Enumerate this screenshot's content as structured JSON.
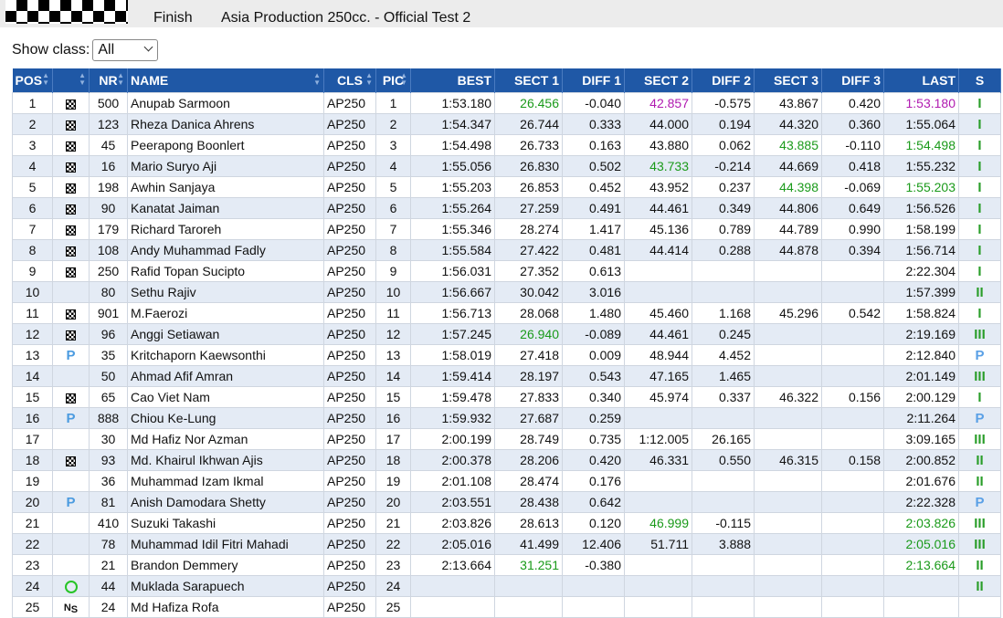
{
  "header": {
    "status": "Finish",
    "title": "Asia Production 250cc. - Official Test 2"
  },
  "filter": {
    "label": "Show class:",
    "value": "All"
  },
  "columns": [
    "POS",
    "",
    "NR",
    "NAME",
    "CLS",
    "PIC",
    "BEST",
    "SECT 1",
    "DIFF 1",
    "SECT 2",
    "DIFF 2",
    "SECT 3",
    "DIFF 3",
    "LAST",
    "S"
  ],
  "colors": {
    "header_bg": "#1f58a6",
    "alt_row": "#e4ebf5",
    "best_green": "#1a9a1a",
    "overall_purple": "#b01ab0"
  },
  "rows": [
    {
      "pos": "1",
      "icon": "checkered",
      "nr": "500",
      "name": "Anupab Sarmoon",
      "cls": "AP250",
      "pic": "1",
      "best": "1:53.180",
      "s1": "26.456",
      "s1c": "green",
      "d1": "-0.040",
      "s2": "42.857",
      "s2c": "purple",
      "d2": "-0.575",
      "s3": "43.867",
      "s3c": "",
      "d3": "0.420",
      "last": "1:53.180",
      "lastc": "purple",
      "s": "I"
    },
    {
      "pos": "2",
      "icon": "checkered",
      "nr": "123",
      "name": "Rheza Danica Ahrens",
      "cls": "AP250",
      "pic": "2",
      "best": "1:54.347",
      "s1": "26.744",
      "s1c": "",
      "d1": "0.333",
      "s2": "44.000",
      "s2c": "",
      "d2": "0.194",
      "s3": "44.320",
      "s3c": "",
      "d3": "0.360",
      "last": "1:55.064",
      "lastc": "",
      "s": "I"
    },
    {
      "pos": "3",
      "icon": "checkered",
      "nr": "45",
      "name": "Peerapong Boonlert",
      "cls": "AP250",
      "pic": "3",
      "best": "1:54.498",
      "s1": "26.733",
      "s1c": "",
      "d1": "0.163",
      "s2": "43.880",
      "s2c": "",
      "d2": "0.062",
      "s3": "43.885",
      "s3c": "green",
      "d3": "-0.110",
      "last": "1:54.498",
      "lastc": "green",
      "s": "I"
    },
    {
      "pos": "4",
      "icon": "checkered",
      "nr": "16",
      "name": "Mario Suryo Aji",
      "cls": "AP250",
      "pic": "4",
      "best": "1:55.056",
      "s1": "26.830",
      "s1c": "",
      "d1": "0.502",
      "s2": "43.733",
      "s2c": "green",
      "d2": "-0.214",
      "s3": "44.669",
      "s3c": "",
      "d3": "0.418",
      "last": "1:55.232",
      "lastc": "",
      "s": "I"
    },
    {
      "pos": "5",
      "icon": "checkered",
      "nr": "198",
      "name": "Awhin Sanjaya",
      "cls": "AP250",
      "pic": "5",
      "best": "1:55.203",
      "s1": "26.853",
      "s1c": "",
      "d1": "0.452",
      "s2": "43.952",
      "s2c": "",
      "d2": "0.237",
      "s3": "44.398",
      "s3c": "green",
      "d3": "-0.069",
      "last": "1:55.203",
      "lastc": "green",
      "s": "I"
    },
    {
      "pos": "6",
      "icon": "checkered",
      "nr": "90",
      "name": "Kanatat Jaiman",
      "cls": "AP250",
      "pic": "6",
      "best": "1:55.264",
      "s1": "27.259",
      "s1c": "",
      "d1": "0.491",
      "s2": "44.461",
      "s2c": "",
      "d2": "0.349",
      "s3": "44.806",
      "s3c": "",
      "d3": "0.649",
      "last": "1:56.526",
      "lastc": "",
      "s": "I"
    },
    {
      "pos": "7",
      "icon": "checkered",
      "nr": "179",
      "name": "Richard Taroreh",
      "cls": "AP250",
      "pic": "7",
      "best": "1:55.346",
      "s1": "28.274",
      "s1c": "",
      "d1": "1.417",
      "s2": "45.136",
      "s2c": "",
      "d2": "0.789",
      "s3": "44.789",
      "s3c": "",
      "d3": "0.990",
      "last": "1:58.199",
      "lastc": "",
      "s": "I"
    },
    {
      "pos": "8",
      "icon": "checkered",
      "nr": "108",
      "name": "Andy Muhammad Fadly",
      "cls": "AP250",
      "pic": "8",
      "best": "1:55.584",
      "s1": "27.422",
      "s1c": "",
      "d1": "0.481",
      "s2": "44.414",
      "s2c": "",
      "d2": "0.288",
      "s3": "44.878",
      "s3c": "",
      "d3": "0.394",
      "last": "1:56.714",
      "lastc": "",
      "s": "I"
    },
    {
      "pos": "9",
      "icon": "checkered",
      "nr": "250",
      "name": "Rafid Topan Sucipto",
      "cls": "AP250",
      "pic": "9",
      "best": "1:56.031",
      "s1": "27.352",
      "s1c": "",
      "d1": "0.613",
      "s2": "",
      "s2c": "",
      "d2": "",
      "s3": "",
      "s3c": "",
      "d3": "",
      "last": "2:22.304",
      "lastc": "",
      "s": "I"
    },
    {
      "pos": "10",
      "icon": "",
      "nr": "80",
      "name": "Sethu Rajiv",
      "cls": "AP250",
      "pic": "10",
      "best": "1:56.667",
      "s1": "30.042",
      "s1c": "",
      "d1": "3.016",
      "s2": "",
      "s2c": "",
      "d2": "",
      "s3": "",
      "s3c": "",
      "d3": "",
      "last": "1:57.399",
      "lastc": "",
      "s": "II"
    },
    {
      "pos": "11",
      "icon": "checkered",
      "nr": "901",
      "name": "M.Faerozi",
      "cls": "AP250",
      "pic": "11",
      "best": "1:56.713",
      "s1": "28.068",
      "s1c": "",
      "d1": "1.480",
      "s2": "45.460",
      "s2c": "",
      "d2": "1.168",
      "s3": "45.296",
      "s3c": "",
      "d3": "0.542",
      "last": "1:58.824",
      "lastc": "",
      "s": "I"
    },
    {
      "pos": "12",
      "icon": "checkered",
      "nr": "96",
      "name": "Anggi Setiawan",
      "cls": "AP250",
      "pic": "12",
      "best": "1:57.245",
      "s1": "26.940",
      "s1c": "green",
      "d1": "-0.089",
      "s2": "44.461",
      "s2c": "",
      "d2": "0.245",
      "s3": "",
      "s3c": "",
      "d3": "",
      "last": "2:19.169",
      "lastc": "",
      "s": "III"
    },
    {
      "pos": "13",
      "icon": "pit",
      "nr": "35",
      "name": "Kritchaporn Kaewsonthi",
      "cls": "AP250",
      "pic": "13",
      "best": "1:58.019",
      "s1": "27.418",
      "s1c": "",
      "d1": "0.009",
      "s2": "48.944",
      "s2c": "",
      "d2": "4.452",
      "s3": "",
      "s3c": "",
      "d3": "",
      "last": "2:12.840",
      "lastc": "",
      "s": "P"
    },
    {
      "pos": "14",
      "icon": "",
      "nr": "50",
      "name": "Ahmad Afif Amran",
      "cls": "AP250",
      "pic": "14",
      "best": "1:59.414",
      "s1": "28.197",
      "s1c": "",
      "d1": "0.543",
      "s2": "47.165",
      "s2c": "",
      "d2": "1.465",
      "s3": "",
      "s3c": "",
      "d3": "",
      "last": "2:01.149",
      "lastc": "",
      "s": "III"
    },
    {
      "pos": "15",
      "icon": "checkered",
      "nr": "65",
      "name": "Cao Viet Nam",
      "cls": "AP250",
      "pic": "15",
      "best": "1:59.478",
      "s1": "27.833",
      "s1c": "",
      "d1": "0.340",
      "s2": "45.974",
      "s2c": "",
      "d2": "0.337",
      "s3": "46.322",
      "s3c": "",
      "d3": "0.156",
      "last": "2:00.129",
      "lastc": "",
      "s": "I"
    },
    {
      "pos": "16",
      "icon": "pit",
      "nr": "888",
      "name": "Chiou Ke-Lung",
      "cls": "AP250",
      "pic": "16",
      "best": "1:59.932",
      "s1": "27.687",
      "s1c": "",
      "d1": "0.259",
      "s2": "",
      "s2c": "",
      "d2": "",
      "s3": "",
      "s3c": "",
      "d3": "",
      "last": "2:11.264",
      "lastc": "",
      "s": "P"
    },
    {
      "pos": "17",
      "icon": "",
      "nr": "30",
      "name": "Md Hafiz Nor Azman",
      "cls": "AP250",
      "pic": "17",
      "best": "2:00.199",
      "s1": "28.749",
      "s1c": "",
      "d1": "0.735",
      "s2": "1:12.005",
      "s2c": "",
      "d2": "26.165",
      "s3": "",
      "s3c": "",
      "d3": "",
      "last": "3:09.165",
      "lastc": "",
      "s": "III"
    },
    {
      "pos": "18",
      "icon": "checkered",
      "nr": "93",
      "name": "Md. Khairul Ikhwan Ajis",
      "cls": "AP250",
      "pic": "18",
      "best": "2:00.378",
      "s1": "28.206",
      "s1c": "",
      "d1": "0.420",
      "s2": "46.331",
      "s2c": "",
      "d2": "0.550",
      "s3": "46.315",
      "s3c": "",
      "d3": "0.158",
      "last": "2:00.852",
      "lastc": "",
      "s": "II"
    },
    {
      "pos": "19",
      "icon": "",
      "nr": "36",
      "name": "Muhammad Izam Ikmal",
      "cls": "AP250",
      "pic": "19",
      "best": "2:01.108",
      "s1": "28.474",
      "s1c": "",
      "d1": "0.176",
      "s2": "",
      "s2c": "",
      "d2": "",
      "s3": "",
      "s3c": "",
      "d3": "",
      "last": "2:01.676",
      "lastc": "",
      "s": "II"
    },
    {
      "pos": "20",
      "icon": "pit",
      "nr": "81",
      "name": "Anish Damodara Shetty",
      "cls": "AP250",
      "pic": "20",
      "best": "2:03.551",
      "s1": "28.438",
      "s1c": "",
      "d1": "0.642",
      "s2": "",
      "s2c": "",
      "d2": "",
      "s3": "",
      "s3c": "",
      "d3": "",
      "last": "2:22.328",
      "lastc": "",
      "s": "P"
    },
    {
      "pos": "21",
      "icon": "",
      "nr": "410",
      "name": "Suzuki Takashi",
      "cls": "AP250",
      "pic": "21",
      "best": "2:03.826",
      "s1": "28.613",
      "s1c": "",
      "d1": "0.120",
      "s2": "46.999",
      "s2c": "green",
      "d2": "-0.115",
      "s3": "",
      "s3c": "",
      "d3": "",
      "last": "2:03.826",
      "lastc": "green",
      "s": "III"
    },
    {
      "pos": "22",
      "icon": "",
      "nr": "78",
      "name": "Muhammad Idil Fitri Mahadi",
      "cls": "AP250",
      "pic": "22",
      "best": "2:05.016",
      "s1": "41.499",
      "s1c": "",
      "d1": "12.406",
      "s2": "51.711",
      "s2c": "",
      "d2": "3.888",
      "s3": "",
      "s3c": "",
      "d3": "",
      "last": "2:05.016",
      "lastc": "green",
      "s": "III"
    },
    {
      "pos": "23",
      "icon": "",
      "nr": "21",
      "name": "Brandon Demmery",
      "cls": "AP250",
      "pic": "23",
      "best": "2:13.664",
      "s1": "31.251",
      "s1c": "green",
      "d1": "-0.380",
      "s2": "",
      "s2c": "",
      "d2": "",
      "s3": "",
      "s3c": "",
      "d3": "",
      "last": "2:13.664",
      "lastc": "green",
      "s": "II"
    },
    {
      "pos": "24",
      "icon": "out",
      "nr": "44",
      "name": "Muklada Sarapuech",
      "cls": "AP250",
      "pic": "24",
      "best": "",
      "s1": "",
      "s1c": "",
      "d1": "",
      "s2": "",
      "s2c": "",
      "d2": "",
      "s3": "",
      "s3c": "",
      "d3": "",
      "last": "",
      "lastc": "",
      "s": "II"
    },
    {
      "pos": "25",
      "icon": "ns",
      "nr": "24",
      "name": "Md Hafiza Rofa",
      "cls": "AP250",
      "pic": "25",
      "best": "",
      "s1": "",
      "s1c": "",
      "d1": "",
      "s2": "",
      "s2c": "",
      "d2": "",
      "s3": "",
      "s3c": "",
      "d3": "",
      "last": "",
      "lastc": "",
      "s": ""
    }
  ]
}
